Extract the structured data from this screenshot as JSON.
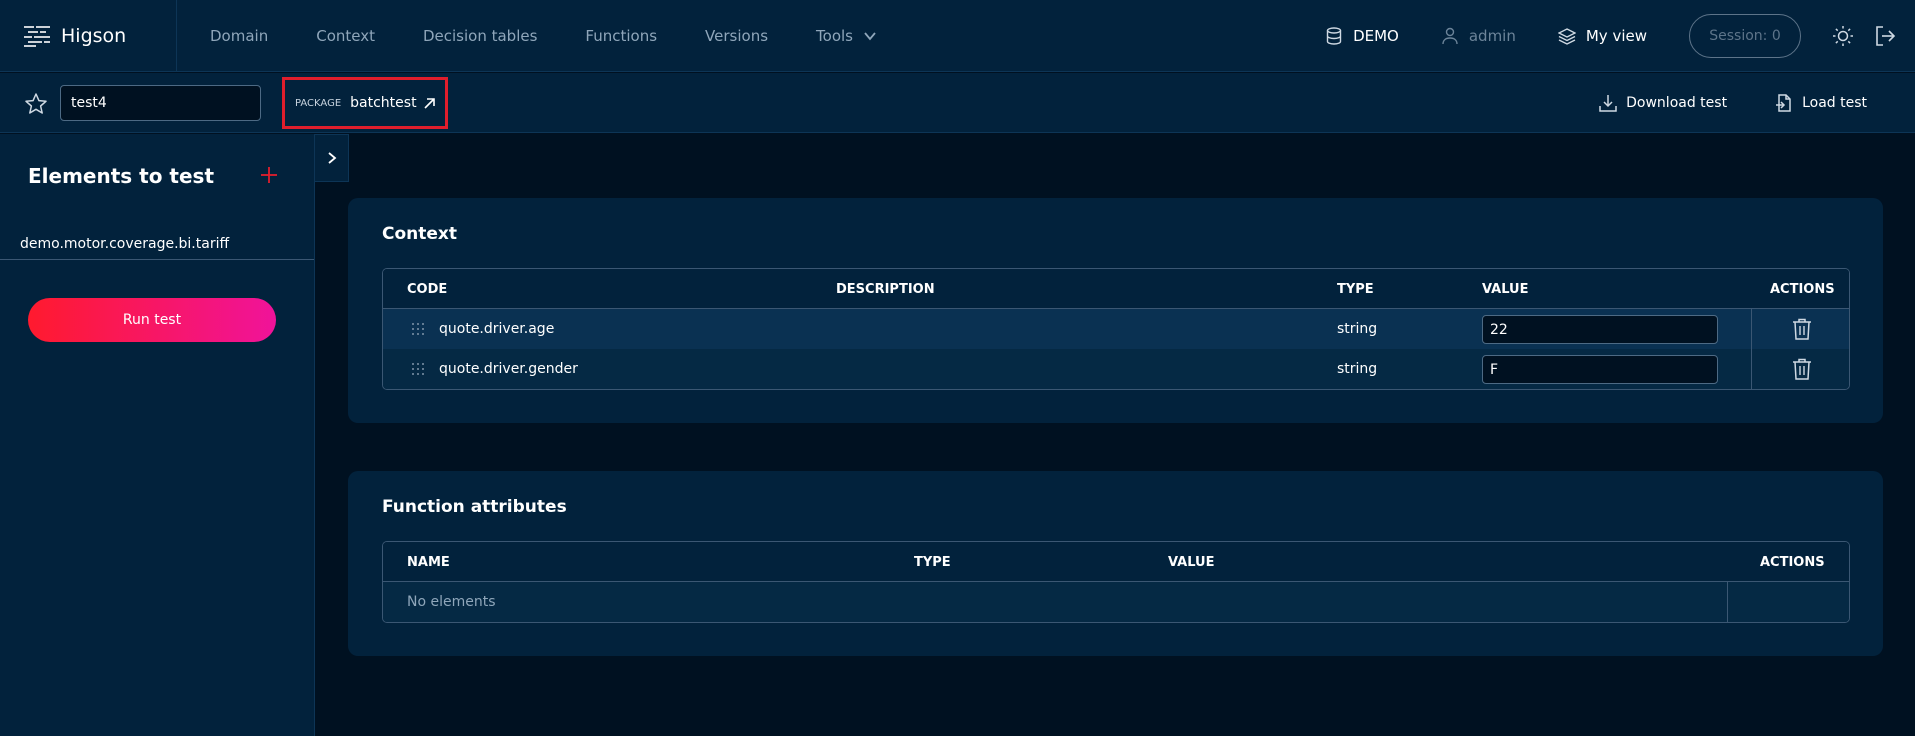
{
  "app": {
    "name": "Higson"
  },
  "nav": {
    "items": [
      "Domain",
      "Context",
      "Decision tables",
      "Functions",
      "Versions",
      "Tools"
    ]
  },
  "top_right": {
    "environment": "DEMO",
    "user": "admin",
    "view": "My view",
    "session": "Session: 0"
  },
  "subbar": {
    "test_name": "test4",
    "package_label": "PACKAGE",
    "package_name": "batchtest",
    "download_label": "Download test",
    "load_label": "Load test"
  },
  "left_panel": {
    "title": "Elements to test",
    "items": [
      "demo.motor.coverage.bi.tariff"
    ],
    "run_label": "Run test"
  },
  "context": {
    "title": "Context",
    "headers": {
      "code": "CODE",
      "description": "DESCRIPTION",
      "type": "TYPE",
      "value": "VALUE",
      "actions": "ACTIONS"
    },
    "rows": [
      {
        "code": "quote.driver.age",
        "description": "",
        "type": "string",
        "value": "22"
      },
      {
        "code": "quote.driver.gender",
        "description": "",
        "type": "string",
        "value": "F"
      }
    ]
  },
  "function_attributes": {
    "title": "Function attributes",
    "headers": {
      "name": "NAME",
      "type": "TYPE",
      "value": "VALUE",
      "actions": "ACTIONS"
    },
    "empty_text": "No elements"
  },
  "colors": {
    "accent_red": "#e01e2c",
    "run_gradient_start": "#ff1a2e",
    "run_gradient_end": "#f0139a",
    "background": "#001121",
    "panel": "#02223c"
  }
}
